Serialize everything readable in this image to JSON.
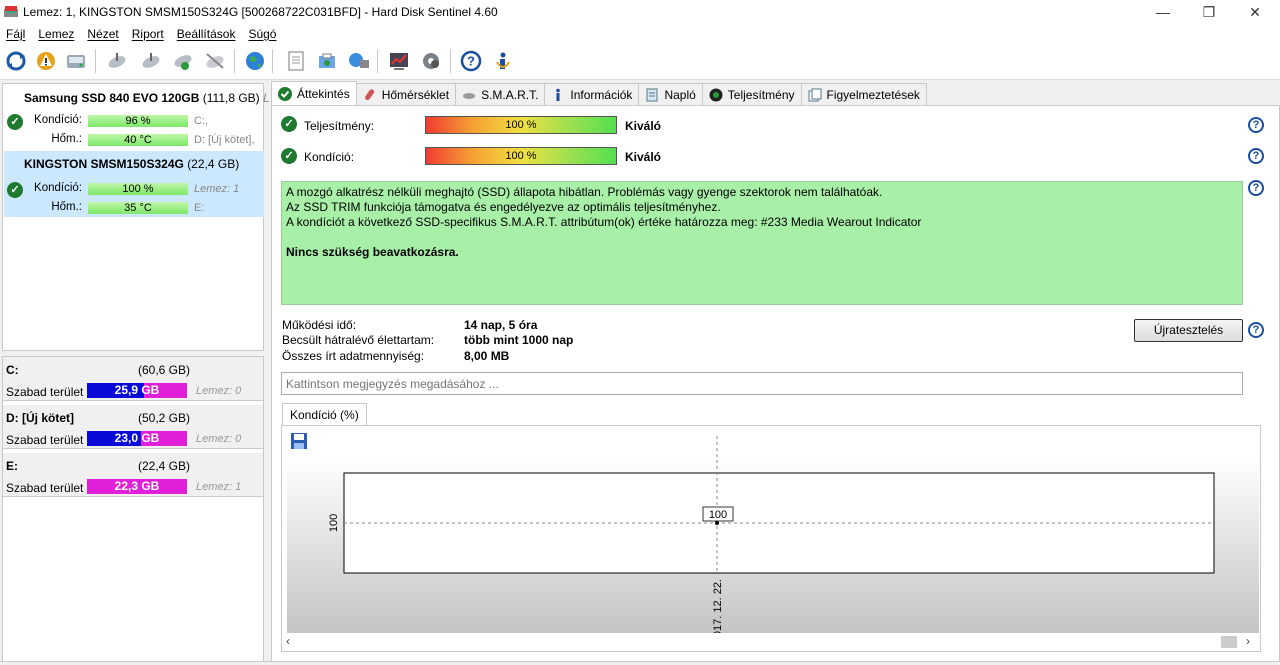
{
  "window": {
    "title": "Lemez: 1, KINGSTON SMSM150S324G [500268722C031BFD]  -  Hard Disk Sentinel 4.60",
    "minimize": "—",
    "restore": "❐",
    "close": "✕"
  },
  "menu": [
    "Fájl",
    "Lemez",
    "Nézet",
    "Riport",
    "Beállítások",
    "Súgó"
  ],
  "disks": [
    {
      "name": "Samsung SSD 840 EVO 120GB",
      "capacity": "(111,8 GB)",
      "cut": "Le",
      "health_label": "Kondíció:",
      "health_value": "96 %",
      "health_note": "C:,",
      "temp_label": "Hőm.:",
      "temp_value": "40 °C",
      "temp_note": "D: [Új kötet],"
    },
    {
      "name": "KINGSTON SMSM150S324G",
      "capacity": "(22,4 GB)",
      "health_label": "Kondíció:",
      "health_value": "100 %",
      "health_note": "Lemez: 1",
      "temp_label": "Hőm.:",
      "temp_value": "35 °C",
      "temp_note": "E:"
    }
  ],
  "volumes": [
    {
      "name": "C:",
      "capacity": "(60,6 GB)",
      "free_label": "Szabad terület",
      "free": "25,9 GB",
      "used_fraction": 0.57,
      "disk": "Lemez: 0"
    },
    {
      "name": "D: [Új kötet]",
      "capacity": "(50,2 GB)",
      "free_label": "Szabad terület",
      "free": "23,0 GB",
      "used_fraction": 0.54,
      "disk": "Lemez: 0"
    },
    {
      "name": "E:",
      "capacity": "(22,4 GB)",
      "free_label": "Szabad terület",
      "free": "22,3 GB",
      "used_fraction": 0.0,
      "disk": "Lemez: 1"
    }
  ],
  "tabs": [
    "Áttekintés",
    "Hőmérséklet",
    "S.M.A.R.T.",
    "Információk",
    "Napló",
    "Teljesítmény",
    "Figyelmeztetések"
  ],
  "overview": {
    "performance_label": "Teljesítmény:",
    "performance_value": "100 %",
    "performance_rating": "Kiváló",
    "health_label": "Kondíció:",
    "health_value": "100 %",
    "health_rating": "Kiváló",
    "message_lines": [
      "A mozgó alkatrész nélküli meghajtó (SSD) állapota hibátlan. Problémás vagy gyenge szektorok nem találhatóak.",
      "Az SSD TRIM funkciója támogatva és engedélyezve az optimális teljesítményhez.",
      "A kondíciót a következő SSD-specifikus S.M.A.R.T. attribútum(ok) értéke határozza meg:  #233 Media Wearout Indicator"
    ],
    "message_bold": "Nincs szükség beavatkozásra.",
    "power_on_label": "Működési idő:",
    "power_on_value": "14 nap, 5 óra",
    "lifetime_label": "Becsült hátralévő élettartam:",
    "lifetime_value": "több mint 1000 nap",
    "written_label": "Összes írt adatmennyiség:",
    "written_value": "8,00 MB",
    "retest_button": "Újratesztelés",
    "note_placeholder": "Kattintson megjegyzés megadásához ...",
    "chart_tab": "Kondíció  (%)",
    "help": "?"
  },
  "chart_data": {
    "type": "line",
    "x": [
      "2017. 12. 22."
    ],
    "series": [
      {
        "values": [
          100
        ]
      }
    ],
    "data_labels": [
      "100"
    ],
    "ytick": "100",
    "grid": true
  },
  "colors": {
    "selected_disk": "#cce8ff",
    "ok_green": "#1d7a2f",
    "message_bg": "#a8f0a8",
    "free_used": "#0a0ad8",
    "free_rest": "#e020d8"
  }
}
